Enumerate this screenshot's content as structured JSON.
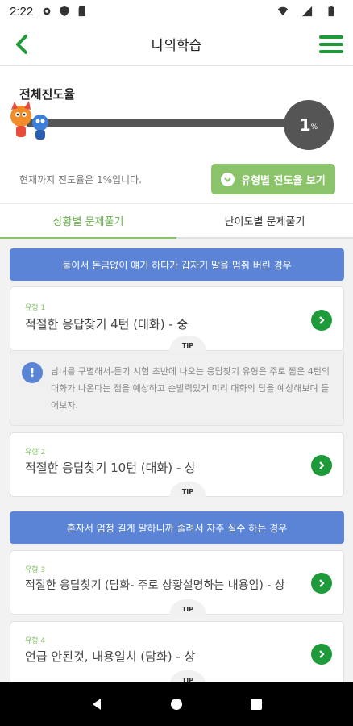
{
  "status_bar": {
    "time": "2:22",
    "icons": [
      "gear-icon",
      "shield-icon",
      "sd-card-icon",
      "wifi-icon",
      "signal-icon",
      "battery-icon"
    ]
  },
  "app_bar": {
    "title": "나의학습",
    "back_icon": "chevron-left-icon",
    "menu_icon": "hamburger-menu-icon"
  },
  "progress": {
    "label": "전체진도율",
    "percent_value": 1,
    "percent_number": "1",
    "percent_unit": "%",
    "description": "현재까지 진도율은 1%입니다.",
    "button_label": "유형별 진도율 보기"
  },
  "tabs": [
    {
      "label": "상황별 문제풀기",
      "active": true
    },
    {
      "label": "난이도별 문제풀기",
      "active": false
    }
  ],
  "sections": [
    {
      "header": "둘이서 돈금없이 얘기 하다가 갑자기 말을 멈춰 버린 경우"
    },
    {
      "header": "혼자서 엄청 길게 말하니까 졸려서 자주 실수 하는 경우"
    }
  ],
  "cards": [
    {
      "type_label": "유형 1",
      "title": "적절한 응답찾기 4턴 (대화) - 중",
      "tip": "TIP"
    },
    {
      "type_label": "유형 2",
      "title": "적절한 응답찾기 10턴 (대화) - 상",
      "tip": "TIP"
    },
    {
      "type_label": "유형 3",
      "title": "적절한 응답찾기 (담화- 주로 상황설명하는 내용임) - 상",
      "tip": "TIP"
    },
    {
      "type_label": "유형 4",
      "title": "언급 안된것, 내용일치 (담화) - 상",
      "tip": "TIP"
    }
  ],
  "tip_content": {
    "text": "남녀를 구별해서-듣기 시험 초반에 나오는 응답찾기 유형은 주로 짧은 4턴의 대화가 나온다는 점을 예상하고 순발력있게 미리 대화의 답을 예상해보며 들어보자."
  },
  "colors": {
    "green": "#1f9a3a",
    "light_green": "#8ac36a",
    "blue": "#5b84d6",
    "progress_gray": "#555555"
  }
}
